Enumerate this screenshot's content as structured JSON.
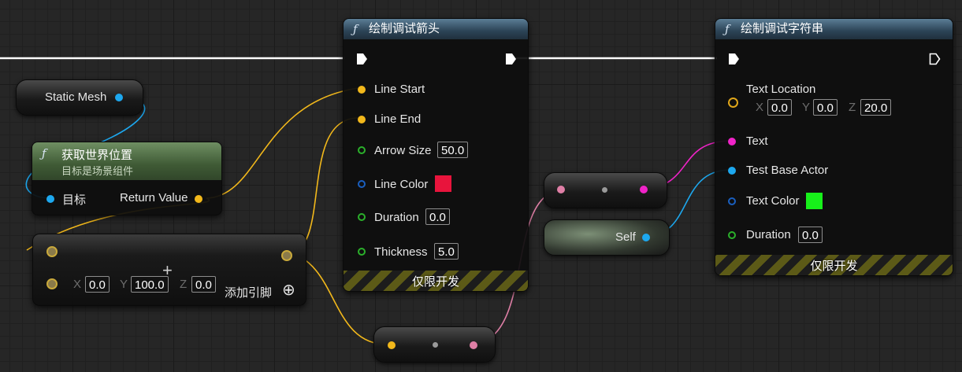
{
  "nodes": {
    "static_mesh": {
      "label": "Static Mesh"
    },
    "get_world_location": {
      "title": "获取世界位置",
      "subtitle": "目标是场景组件",
      "target_label": "目标",
      "return_label": "Return Value"
    },
    "make_vector": {
      "x_label": "X",
      "x_value": "0.0",
      "y_label": "Y",
      "y_value": "100.0",
      "z_label": "Z",
      "z_value": "0.0",
      "add_pin_label": "添加引脚"
    },
    "draw_debug_arrow": {
      "title": "绘制调试箭头",
      "line_start": "Line Start",
      "line_end": "Line End",
      "arrow_size_label": "Arrow Size",
      "arrow_size_value": "50.0",
      "line_color_label": "Line Color",
      "line_color": "#e8143c",
      "duration_label": "Duration",
      "duration_value": "0.0",
      "thickness_label": "Thickness",
      "thickness_value": "5.0",
      "footer": "仅限开发"
    },
    "draw_debug_string": {
      "title": "绘制调试字符串",
      "text_location_label": "Text Location",
      "x_label": "X",
      "x_value": "0.0",
      "y_label": "Y",
      "y_value": "0.0",
      "z_label": "Z",
      "z_value": "20.0",
      "text_label": "Text",
      "test_base_actor_label": "Test Base Actor",
      "text_color_label": "Text Color",
      "text_color": "#17f01a",
      "duration_label": "Duration",
      "duration_value": "0.0",
      "footer": "仅限开发"
    },
    "self_node": {
      "label": "Self"
    }
  },
  "icons": {
    "function": "ƒ",
    "plus": "+",
    "add_pin": "⊕"
  },
  "colors": {
    "exec_wire": "#ffffff",
    "vector_wire": "#f2b81b",
    "object_wire": "#1da8ef",
    "string_wire": "#f023c8",
    "pink_wire": "#df7fa6"
  }
}
